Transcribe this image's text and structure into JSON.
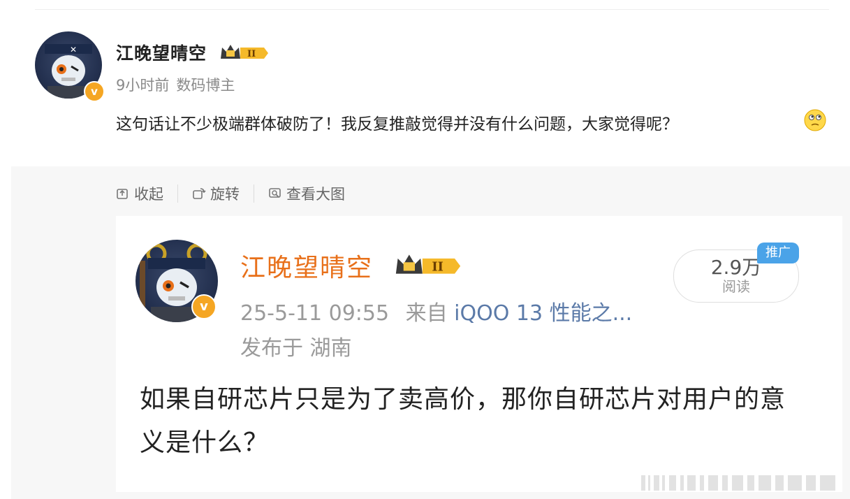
{
  "post": {
    "author": "江晚望晴空",
    "level": "II",
    "time_ago": "9小时前",
    "source": "数码博主",
    "text": "这句话让不少极端群体破防了！我反复推敲觉得并没有什么问题，大家觉得呢？",
    "emoji": "thinking-face"
  },
  "actions": {
    "collapse": "收起",
    "rotate": "旋转",
    "view_large": "查看大图"
  },
  "card": {
    "author": "江晚望晴空",
    "level": "II",
    "datetime": "25-5-11 09:55",
    "from_label": "来自",
    "device": "iQOO 13 性能之...",
    "location": "发布于 湖南",
    "reads_count": "2.9万",
    "reads_label": "阅读",
    "promo_badge": "推广",
    "content": "如果自研芯片只是为了卖高价，那你自研芯片对用户的意义是什么？"
  },
  "colors": {
    "accent_orange": "#e8701a",
    "badge_gold": "#f5a623",
    "link_blue": "#5b7aa8",
    "promo_blue": "#4aa3e8"
  }
}
